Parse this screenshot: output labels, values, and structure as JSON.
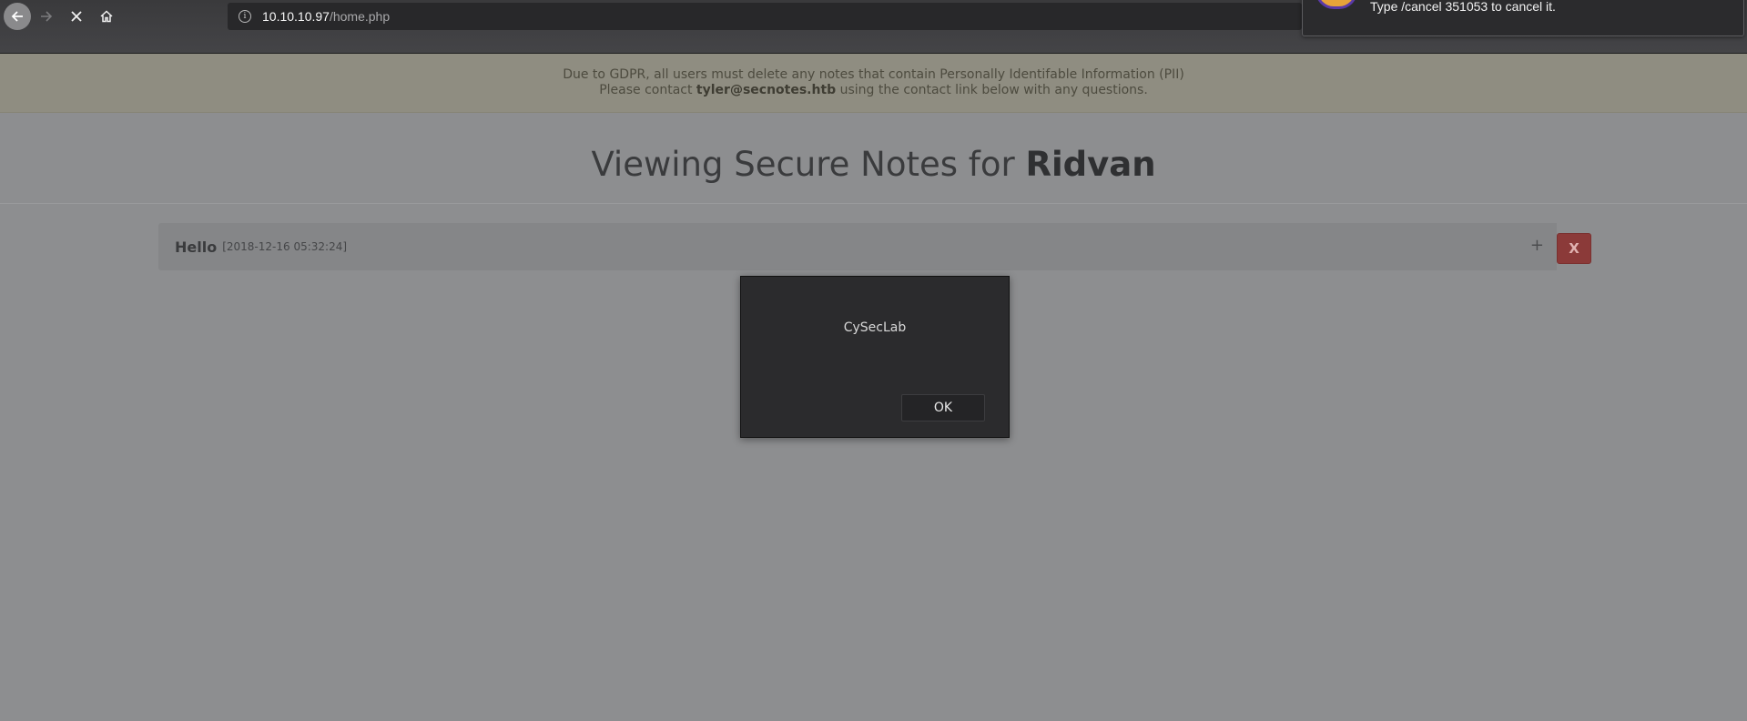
{
  "browser": {
    "url_host": "10.10.10.97",
    "url_path": "/home.php",
    "icons": {
      "back": "back-arrow-icon",
      "forward": "forward-arrow-icon",
      "stop": "close-icon",
      "home": "home-icon",
      "info": "info-icon"
    }
  },
  "notification": {
    "message": "Type /cancel 351053 to cancel it."
  },
  "banner": {
    "line1": "Due to GDPR, all users must delete any notes that contain Personally Identifable Information (PII)",
    "line2_prefix": "Please contact ",
    "line2_email": "tyler@secnotes.htb",
    "line2_suffix": " using the contact link below with any questions."
  },
  "heading": {
    "prefix": "Viewing Secure Notes for ",
    "user": "Ridvan"
  },
  "note": {
    "title": "Hello",
    "date": "[2018-12-16 05:32:24]",
    "expand_label": "+",
    "delete_label": "X"
  },
  "dialog": {
    "message": "CySecLab",
    "ok_label": "OK"
  },
  "colors": {
    "delete_button": "#8b3a39",
    "banner_bg": "#8f8d81",
    "toolbar_bg": "#3a3a3c"
  }
}
